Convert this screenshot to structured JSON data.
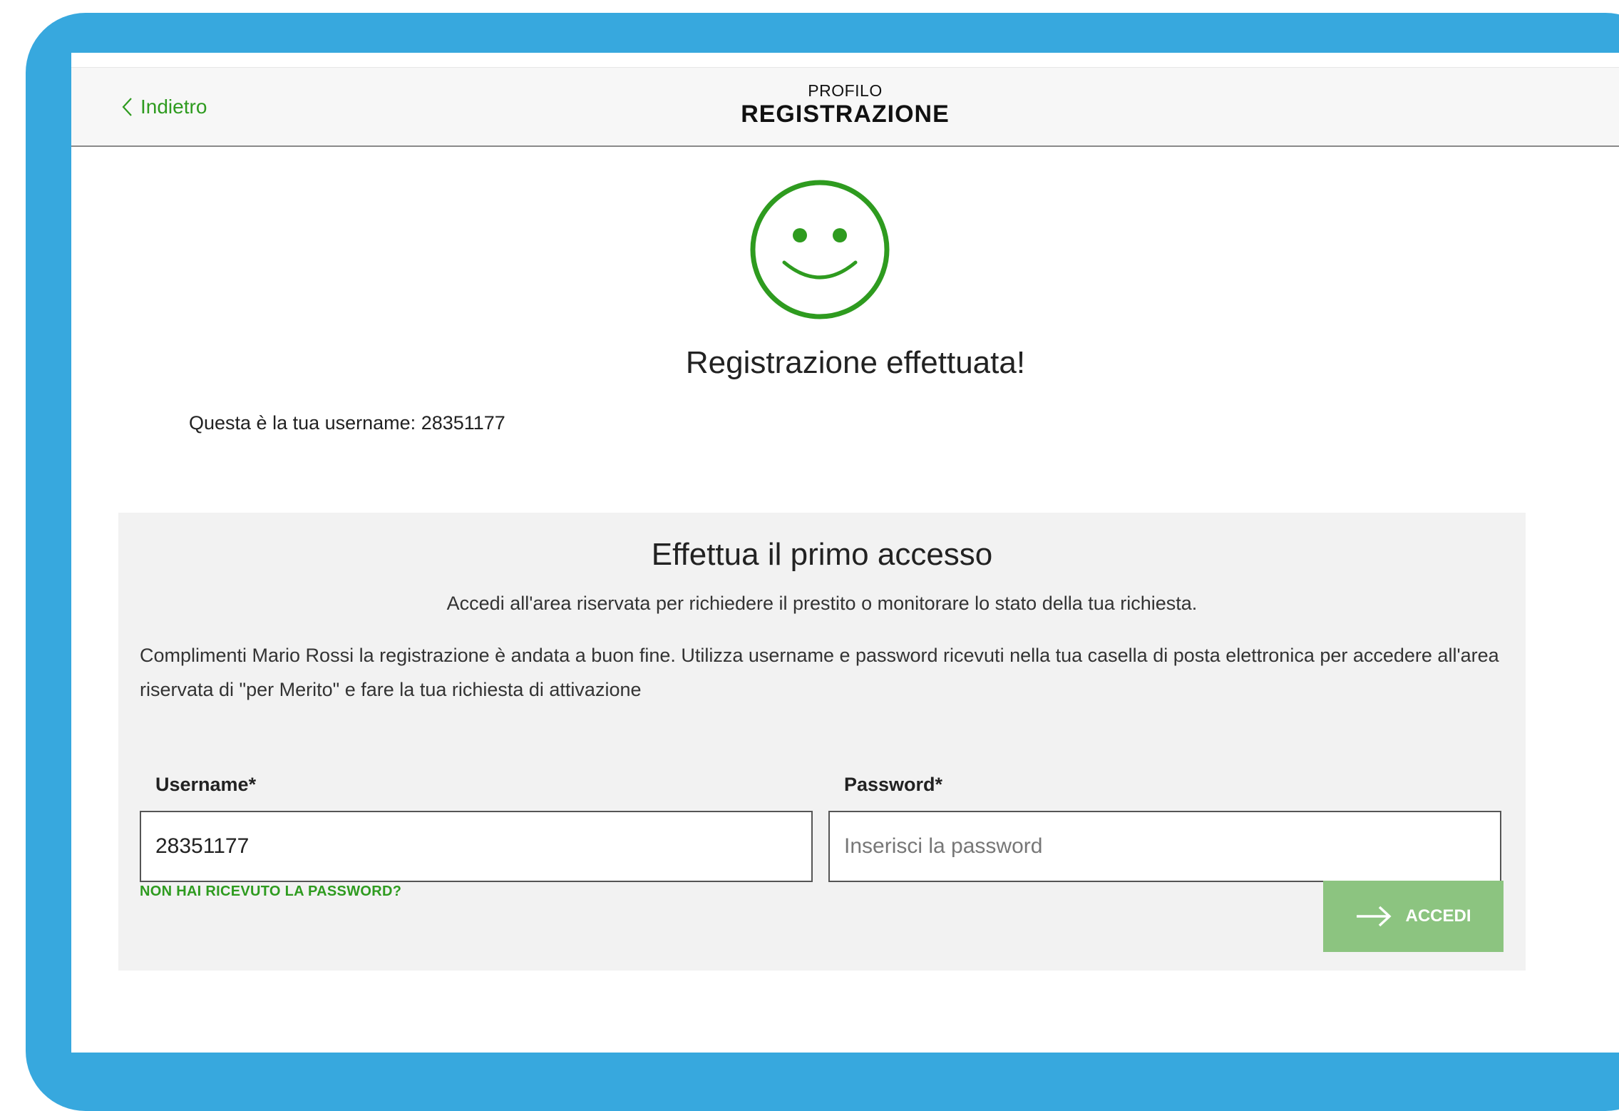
{
  "header": {
    "back_label": "Indietro",
    "kicker": "PROFILO",
    "title": "REGISTRAZIONE"
  },
  "success": {
    "icon": "smiley-icon",
    "title": "Registrazione effettuata!",
    "username_line": "Questa è la tua username: 28351177"
  },
  "login": {
    "title": "Effettua il primo accesso",
    "subtitle": "Accedi all'area riservata per richiedere il prestito o monitorare lo stato della tua richiesta.",
    "body": "Complimenti Mario Rossi la registrazione è andata a buon fine. Utilizza username e password ricevuti nella tua casella di posta elettronica per accedere all'area riservata di \"per Merito\" e fare la tua richiesta di attivazione",
    "username_label": "Username*",
    "username_value": "28351177",
    "password_label": "Password*",
    "password_value": "",
    "password_placeholder": "Inserisci la password",
    "forgot_label": "NON HAI RICEVUTO LA PASSWORD?",
    "submit_label": "ACCEDI",
    "submit_icon": "arrow-right-icon"
  },
  "colors": {
    "frame": "#37a8de",
    "accent_green": "#2e9b1f",
    "button_green": "#8cc480",
    "panel_bg": "#f2f2f2",
    "header_bg": "#f7f7f7"
  }
}
